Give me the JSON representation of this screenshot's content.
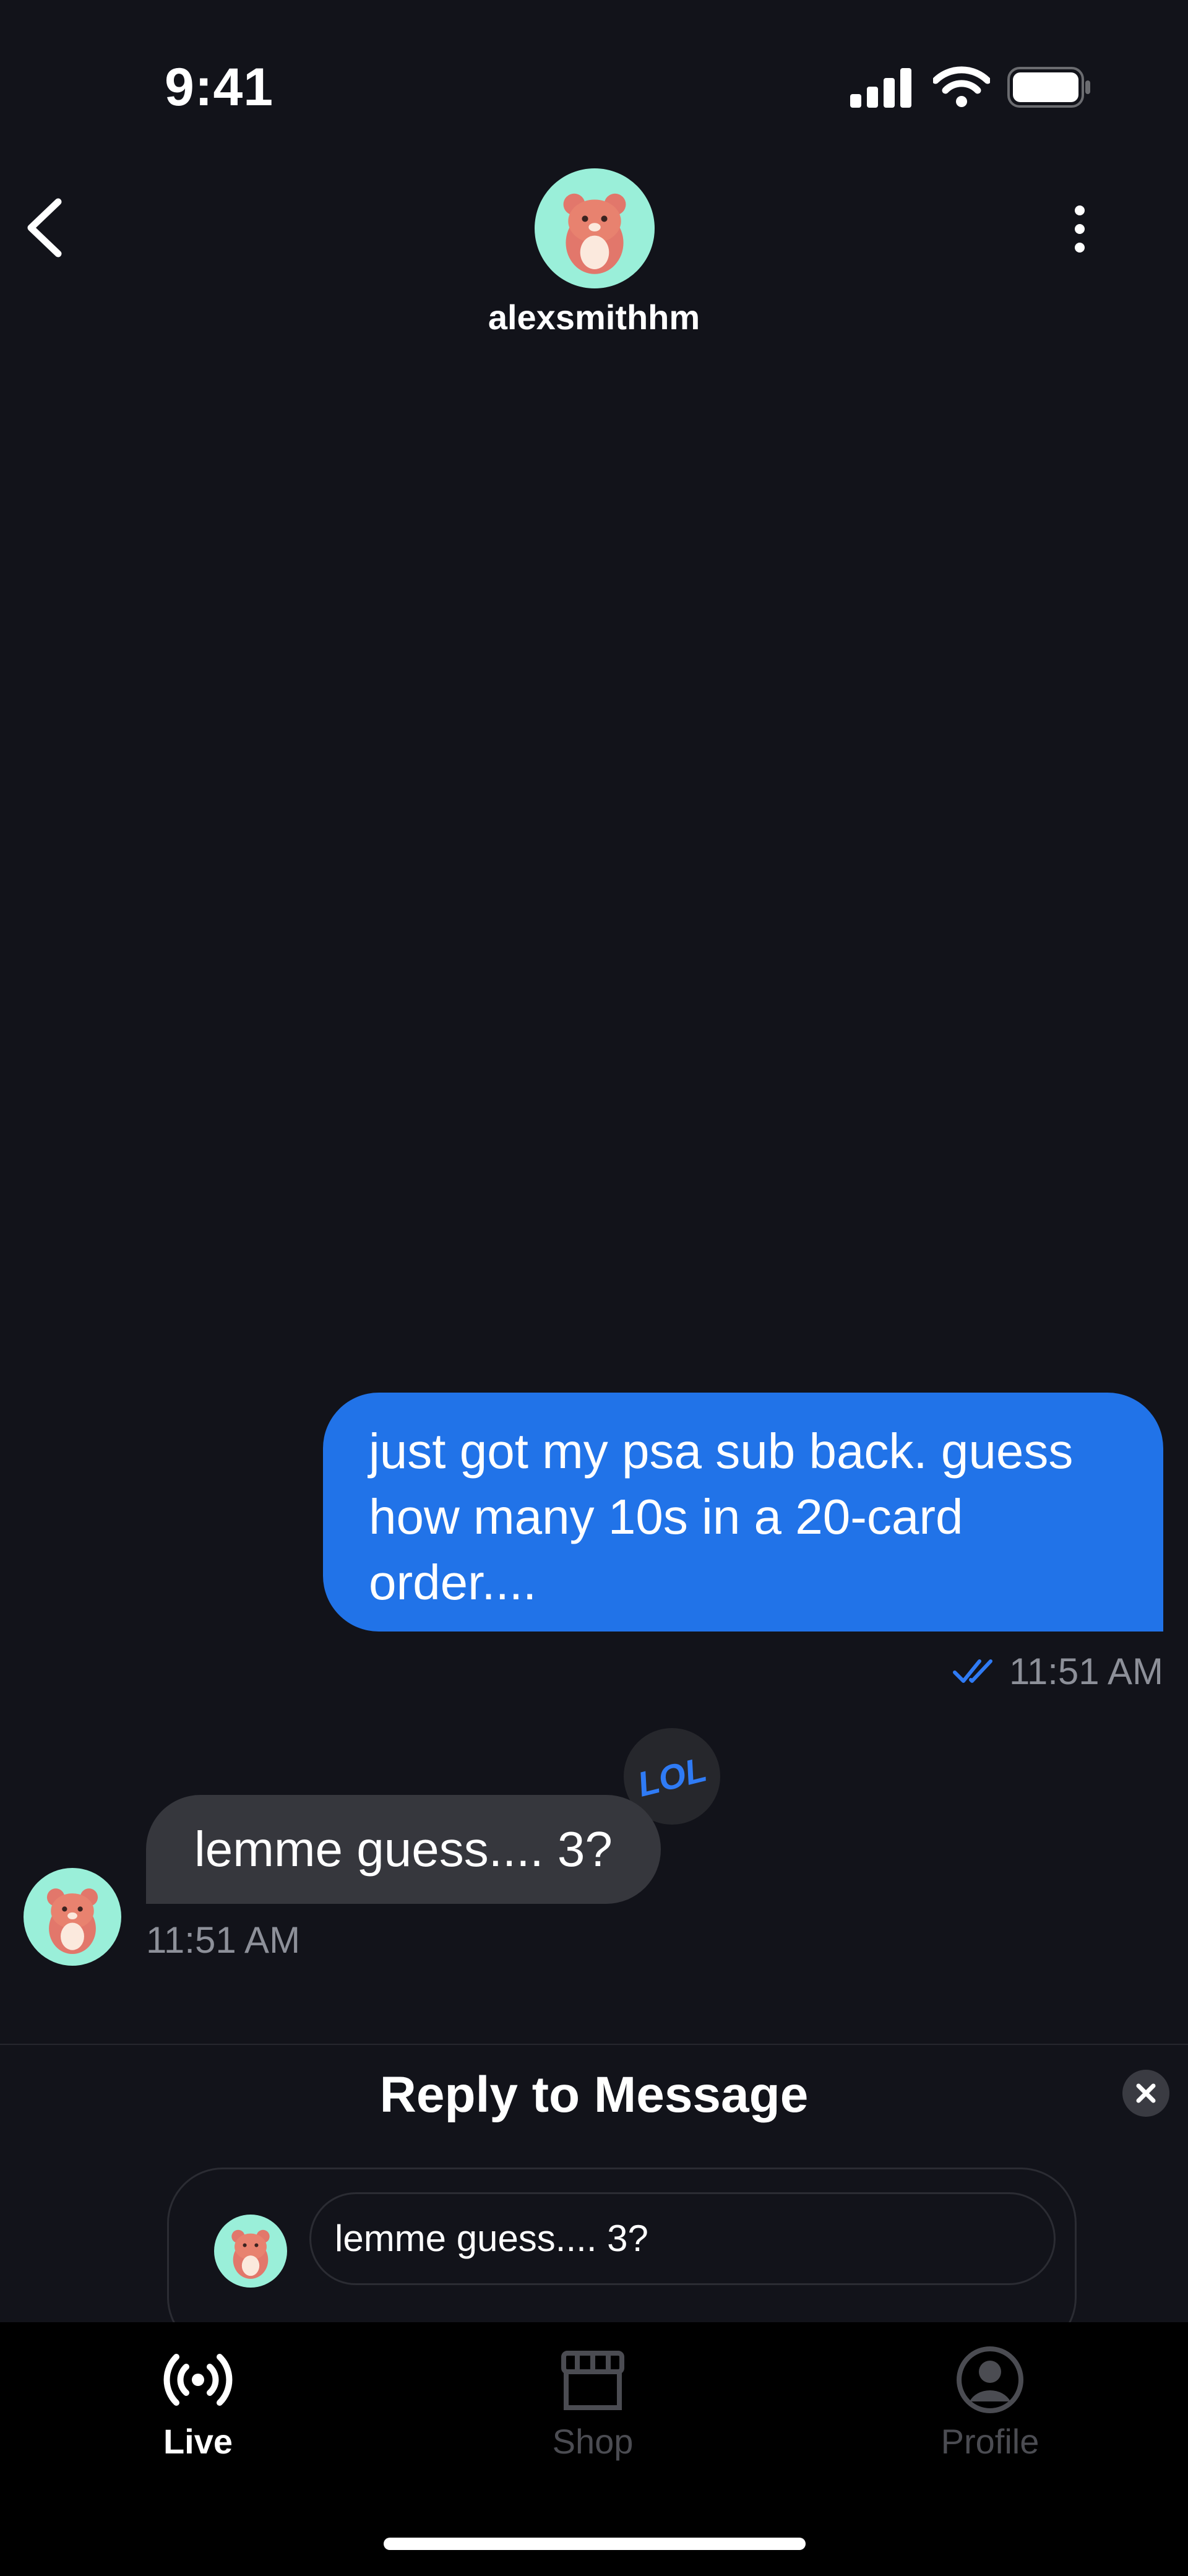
{
  "status_bar": {
    "time": "9:41"
  },
  "header": {
    "username": "alexsmithhm"
  },
  "messages": {
    "sent": {
      "text": "just got my psa sub back. guess how many 10s in a 20-card order....",
      "time": "11:51 AM",
      "read": true
    },
    "received": {
      "text": "lemme guess.... 3?",
      "time": "11:51 AM",
      "reaction": "LOL"
    }
  },
  "reply": {
    "title": "Reply to Message",
    "quoted_text": "lemme guess.... 3?"
  },
  "tabs": [
    {
      "label": "Live",
      "icon": "live-icon",
      "active": true
    },
    {
      "label": "Shop",
      "icon": "shop-icon",
      "active": false
    },
    {
      "label": "Profile",
      "icon": "profile-icon",
      "active": false
    }
  ],
  "colors": {
    "background": "#12131a",
    "sent_bubble": "#2173e8",
    "received_bubble": "#36373d",
    "avatar_bg": "#9aefd9",
    "read_check": "#2f7bf5"
  }
}
